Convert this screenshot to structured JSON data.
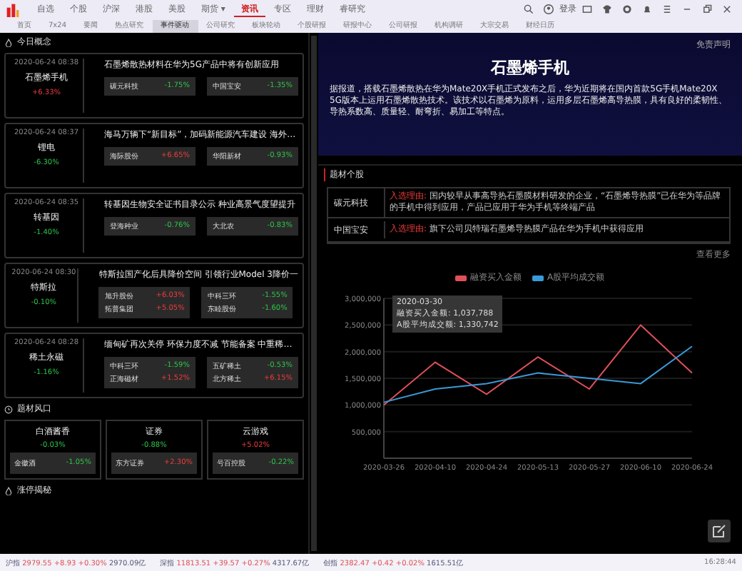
{
  "menu": [
    {
      "label": "自选",
      "selected": false
    },
    {
      "label": "个股",
      "selected": false
    },
    {
      "label": "沪深",
      "selected": false
    },
    {
      "label": "港股",
      "selected": false
    },
    {
      "label": "美股",
      "selected": false
    },
    {
      "label": "期货 ▾",
      "selected": false
    },
    {
      "label": "资讯",
      "selected": true
    },
    {
      "label": "专区",
      "selected": false
    },
    {
      "label": "理财",
      "selected": false
    },
    {
      "label": "睿研究",
      "selected": false
    }
  ],
  "login": "登录",
  "subtabs": [
    {
      "label": "首页",
      "selected": false
    },
    {
      "label": "7x24",
      "selected": false
    },
    {
      "label": "要闻",
      "selected": false
    },
    {
      "label": "热点研究",
      "selected": false
    },
    {
      "label": "事件驱动",
      "selected": true
    },
    {
      "label": "公司研究",
      "selected": false
    },
    {
      "label": "板块轮动",
      "selected": false
    },
    {
      "label": "个股研报",
      "selected": false
    },
    {
      "label": "研报中心",
      "selected": false
    },
    {
      "label": "公司研报",
      "selected": false
    },
    {
      "label": "机构调研",
      "selected": false
    },
    {
      "label": "大宗交易",
      "selected": false
    },
    {
      "label": "财经日历",
      "selected": false
    }
  ],
  "left": {
    "title": "今日概念",
    "concepts": [
      {
        "time": "2020-06-24 08:38",
        "name": "石墨烯手机",
        "change": "+6.33%",
        "up": true,
        "headline": "石墨烯散热材料在华为5G产品中将有创新应用",
        "chips": [
          [
            {
              "name": "碳元科技",
              "change": "-1.75%",
              "up": false
            }
          ],
          [
            {
              "name": "中国宝安",
              "change": "-1.35%",
              "up": false
            }
          ]
        ]
      },
      {
        "time": "2020-06-24 08:37",
        "name": "锂电",
        "change": "-6.30%",
        "up": false,
        "headline": "海马万辆下“新目标”，加码新能源汽车建设 海外…",
        "chips": [
          [
            {
              "name": "海际股份",
              "change": "+6.65%",
              "up": true
            }
          ],
          [
            {
              "name": "华阳新材",
              "change": "-0.93%",
              "up": false
            }
          ]
        ]
      },
      {
        "time": "2020-06-24 08:35",
        "name": "转基因",
        "change": "-1.40%",
        "up": false,
        "headline": "转基因生物安全证书目录公示 种业高景气度望提升",
        "chips": [
          [
            {
              "name": "登海种业",
              "change": "-0.76%",
              "up": false
            }
          ],
          [
            {
              "name": "大北农",
              "change": "-0.83%",
              "up": false
            }
          ]
        ]
      },
      {
        "time": "2020-06-24 08:30",
        "name": "特斯拉",
        "change": "-0.10%",
        "up": false,
        "headline": "特斯拉国产化后具降价空间 引领行业Model 3降价一",
        "chips": [
          [
            {
              "name": "旭升股份",
              "change": "+6.03%",
              "up": true
            },
            {
              "name": "拓普集团",
              "change": "+5.05%",
              "up": true
            }
          ],
          [
            {
              "name": "中科三环",
              "change": "-1.55%",
              "up": false
            },
            {
              "name": "东睦股份",
              "change": "-1.60%",
              "up": false
            }
          ]
        ]
      },
      {
        "time": "2020-06-24 08:28",
        "name": "稀土永磁",
        "change": "-1.16%",
        "up": false,
        "headline": "缅甸矿再次关停 环保力度不减 节能备案 中重稀…",
        "chips": [
          [
            {
              "name": "中科三环",
              "change": "-1.59%",
              "up": false
            },
            {
              "name": "正海磁材",
              "change": "+1.52%",
              "up": true
            }
          ],
          [
            {
              "name": "五矿稀土",
              "change": "-0.53%",
              "up": false
            },
            {
              "name": "北方稀土",
              "change": "+6.15%",
              "up": true
            }
          ]
        ]
      }
    ],
    "section2_title": "题材风口",
    "boards": [
      {
        "name": "白酒酱香",
        "change": "-0.03%",
        "up": false,
        "stock": "金徽酒",
        "stock_change": "-1.05%",
        "stock_up": false
      },
      {
        "name": "证券",
        "change": "-0.88%",
        "up": false,
        "stock": "东方证券",
        "stock_change": "+2.30%",
        "stock_up": true
      },
      {
        "name": "云游戏",
        "change": "+5.02%",
        "up": true,
        "stock": "号百控股",
        "stock_change": "-0.22%",
        "stock_up": false
      }
    ],
    "section3_title": "涨停揭秘"
  },
  "banner": {
    "disclaimer": "免责声明",
    "title": "石墨烯手机",
    "text": "据报道，搭载石墨烯散热在华为Mate20X手机正式发布之后，华为近期将在国内首款5G手机Mate20X 5G版本上运用石墨烯散热技术。该技术以石墨烯为原料，运用多层石墨烯高导热膜，具有良好的柔韧性、导热系数高、质量轻、耐弯折、易加工等特点。"
  },
  "stocks": {
    "title": "题材个股",
    "rows": [
      {
        "name": "碳元科技",
        "tag": "入选理由:",
        "text": "国内较早从事高导热石墨膜材料研发的企业，“石墨烯导热膜”已在华为等品牌的手机中得到应用，产品已应用于华为手机等终端产品"
      },
      {
        "name": "中国宝安",
        "tag": "入选理由:",
        "text": "旗下公司贝特瑞石墨烯导热膜产品在华为手机中获得应用"
      }
    ],
    "more": "查看更多"
  },
  "chart": {
    "chart_data": {
      "type": "line",
      "categories": [
        "2020-03-26",
        "2020-04-10",
        "2020-04-24",
        "2020-05-13",
        "2020-05-27",
        "2020-06-10",
        "2020-06-24"
      ],
      "series": [
        {
          "name": "融资买入金额",
          "color": "#e0505a",
          "values": [
            1000000,
            1800000,
            1200000,
            1900000,
            1300000,
            2500000,
            1600000
          ]
        },
        {
          "name": "A股平均成交额",
          "color": "#3a9ad9",
          "values": [
            1050000,
            1300000,
            1400000,
            1600000,
            1500000,
            1400000,
            2100000
          ]
        }
      ],
      "ylim": [
        0,
        3000000
      ],
      "grid": true,
      "yticks": [
        {
          "value": 500000,
          "label": "500,000"
        },
        {
          "value": 1000000,
          "label": "1,000,000"
        },
        {
          "value": 1500000,
          "label": "1,500,000"
        },
        {
          "value": 2000000,
          "label": "2,000,000"
        },
        {
          "value": 2500000,
          "label": "2,500,000"
        },
        {
          "value": 3000000,
          "label": "3,000,000"
        }
      ]
    },
    "tooltip": {
      "date": "2020-03-30",
      "lines": [
        "融资买入金额: 1,037,788",
        "A股平均成交额: 1,330,742"
      ]
    }
  },
  "status": {
    "indices": [
      {
        "name": "沪指",
        "value": "2979.55",
        "change": "+8.93",
        "pct": "+0.30%",
        "amount": "2970.09亿"
      },
      {
        "name": "深指",
        "value": "11813.51",
        "change": "+39.57",
        "pct": "+0.27%",
        "amount": "4317.67亿"
      },
      {
        "name": "创指",
        "value": "2382.47",
        "change": "+0.42",
        "pct": "+0.02%",
        "amount": "1615.51亿"
      }
    ],
    "time": "16:28:44"
  }
}
